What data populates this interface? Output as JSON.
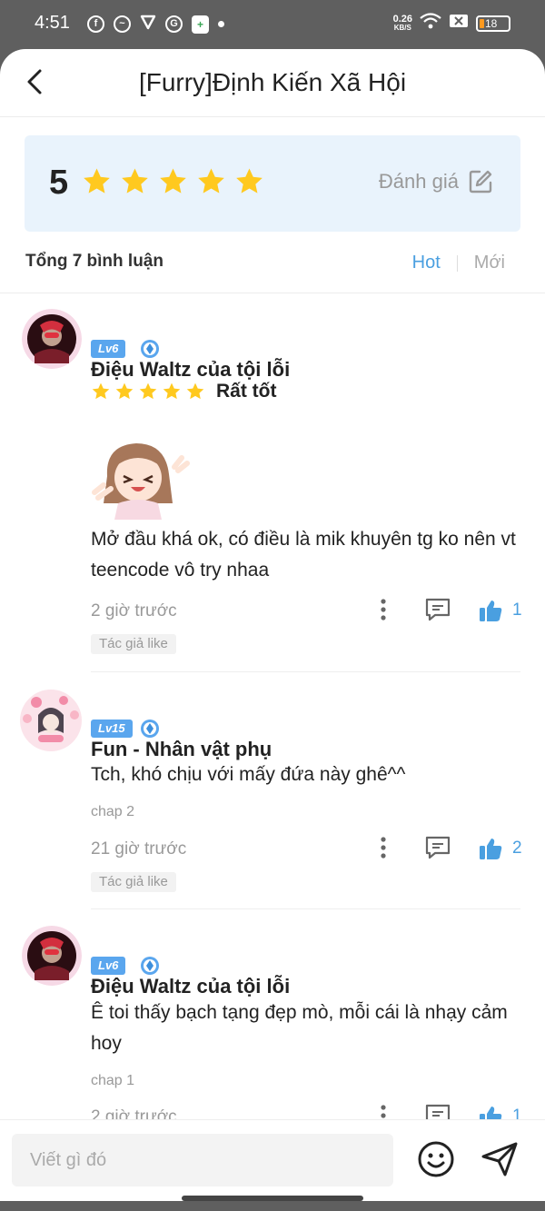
{
  "status_bar": {
    "time": "4:51",
    "net_speed": "0.26",
    "net_unit": "KB/S",
    "battery": "18"
  },
  "header": {
    "title": "[Furry]Định Kiến Xã Hội"
  },
  "rating": {
    "score": "5",
    "stars": 5,
    "rate_label": "Đánh giá"
  },
  "comments_summary": {
    "total_label": "Tổng 7 bình luận",
    "sort_hot": "Hot",
    "sort_new": "Mới"
  },
  "comments": [
    {
      "name": "Điệu Waltz của tội lỗi",
      "level": "Lv6",
      "rating_label": "Rất tốt",
      "text": "Mở đầu khá ok, có điều là mik khuyên tg ko nên vt teencode vô try nhaa",
      "time": "2 giờ trước",
      "likes": "1",
      "author_like": "Tác giả like"
    },
    {
      "name": "Fun - Nhân vật phụ",
      "level": "Lv15",
      "text": "Tch, khó chịu với mấy đứa này ghê^^",
      "chapter": "chap 2",
      "time": "21 giờ trước",
      "likes": "2",
      "author_like": "Tác giả like"
    },
    {
      "name": "Điệu Waltz của tội lỗi",
      "level": "Lv6",
      "text": "Ê toi thấy bạch tạng đẹp mò, mỗi cái là nhạy cảm hoy",
      "chapter": "chap 1",
      "time": "2 giờ trước",
      "likes": "1"
    }
  ],
  "input": {
    "placeholder": "Viết gì đó"
  },
  "colors": {
    "accent": "#4a9fe0",
    "star": "#ffc91f",
    "rating_card_bg": "#e9f3fc"
  }
}
